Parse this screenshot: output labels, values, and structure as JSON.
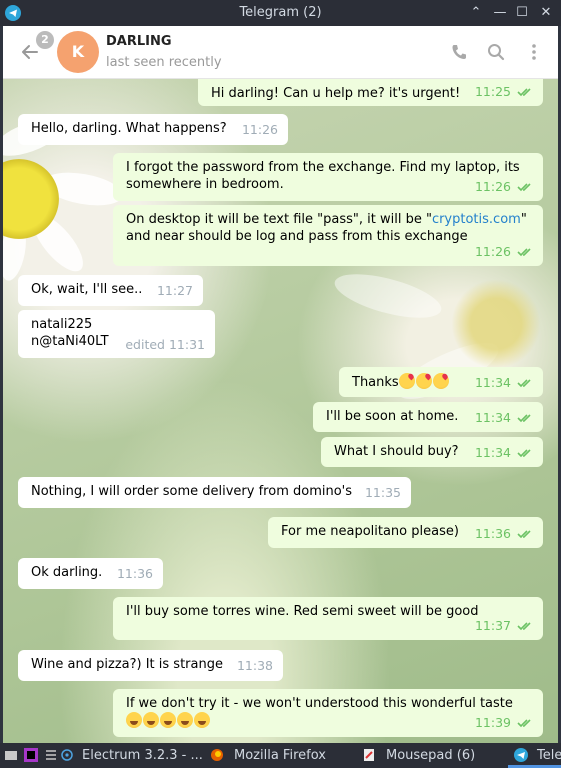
{
  "window": {
    "title": "Telegram (2)",
    "controls": [
      "⌃",
      "—",
      "☐",
      "✕"
    ]
  },
  "header": {
    "unread_count": "2",
    "avatar_letter": "K",
    "peer_name": "DARLING",
    "peer_status": "last seen recently",
    "icons": [
      "phone-icon",
      "search-icon",
      "more-vertical-icon"
    ]
  },
  "messages": [
    {
      "dir": "out",
      "text": "Hi darling! Can u help me? it's urgent!",
      "time": "11:25"
    },
    {
      "dir": "in",
      "text": "Hello, darling. What happens?",
      "time": "11:26"
    },
    {
      "dir": "out",
      "text": "I forgot the password from the exchange. Find my laptop, its somewhere in bedroom.",
      "time": "11:26"
    },
    {
      "dir": "out",
      "text_before": "On desktop it will be text file \"pass\", it will be \"",
      "link": "cryptotis.com",
      "text_after": "\" and near should be log and pass from this exchange",
      "time": "11:26"
    },
    {
      "dir": "in",
      "text": "Ok, wait, I'll see..",
      "time": "11:27"
    },
    {
      "dir": "in",
      "line1": "natali225",
      "line2": "n@taNi40LT",
      "edited": "edited",
      "time": "11:31"
    },
    {
      "dir": "out",
      "text": "Thanks",
      "emoji": [
        "kiss",
        "kiss",
        "kiss"
      ],
      "time": "11:34"
    },
    {
      "dir": "out",
      "text": "I'll be soon at home.",
      "time": "11:34"
    },
    {
      "dir": "out",
      "text": "What I should buy?",
      "time": "11:34"
    },
    {
      "dir": "in",
      "text": "Nothing, I will order some delivery from domino's",
      "time": "11:35"
    },
    {
      "dir": "out",
      "text": "For me neapolitano please)",
      "time": "11:36"
    },
    {
      "dir": "in",
      "text": "Ok darling.",
      "time": "11:36"
    },
    {
      "dir": "out",
      "text": "I'll buy some torres wine. Red semi sweet will be good",
      "time": "11:37"
    },
    {
      "dir": "in",
      "text": "Wine and pizza?) It is strange",
      "time": "11:38"
    },
    {
      "dir": "out",
      "text": "If we don't try it - we won't understood this wonderful taste",
      "emoji": [
        "laugh",
        "laugh",
        "laugh",
        "laugh",
        "laugh"
      ],
      "time": "11:39"
    }
  ],
  "taskbar": {
    "items": [
      {
        "label": "Electrum 3.2.3  - ...",
        "icon": "electrum-icon"
      },
      {
        "label": "Mozilla Firefox",
        "icon": "firefox-icon"
      },
      {
        "label": "Mousepad (6)",
        "icon": "mousepad-icon"
      },
      {
        "label": "Tele",
        "icon": "telegram-icon"
      }
    ]
  },
  "colors": {
    "incoming_bubble": "#ffffff",
    "outgoing_bubble": "#effdde",
    "outgoing_meta": "#6cc264",
    "link": "#2481cc",
    "avatar": "#f5a26f"
  }
}
